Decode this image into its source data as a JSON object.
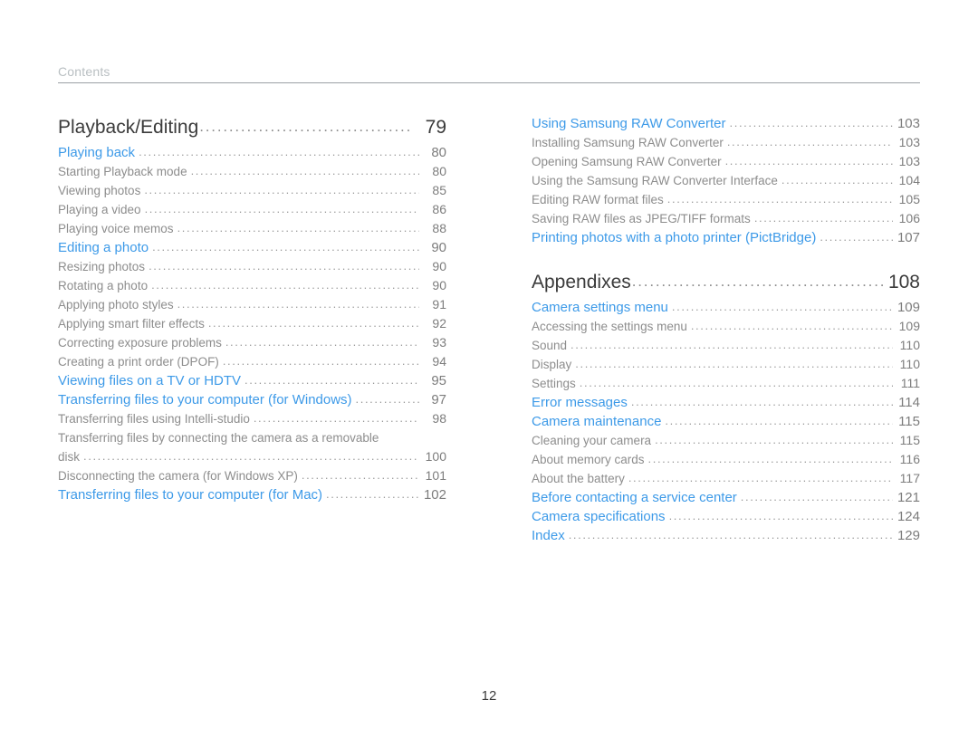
{
  "running_header": {
    "label": "Contents"
  },
  "folio": {
    "page_number": "12"
  },
  "colors": {
    "section_blue": "#3d9ae8",
    "sub_gray": "#8d8d8d",
    "chapter_dark": "#3b3b3b",
    "leader_gray": "#9a9a9a",
    "rule_gray": "#9aa0a4",
    "header_gray": "#b9bfc2"
  },
  "leader": "..................................................................................................",
  "left_column": [
    {
      "level": "chapter",
      "title": "Playback/Editing",
      "page": "79"
    },
    {
      "level": "section",
      "title": "Playing back",
      "page": "80"
    },
    {
      "level": "sub",
      "title": "Starting Playback mode",
      "page": "80"
    },
    {
      "level": "sub",
      "title": "Viewing photos",
      "page": "85"
    },
    {
      "level": "sub",
      "title": "Playing a video",
      "page": "86"
    },
    {
      "level": "sub",
      "title": "Playing voice memos",
      "page": "88"
    },
    {
      "level": "section",
      "title": "Editing a photo",
      "page": "90"
    },
    {
      "level": "sub",
      "title": "Resizing photos",
      "page": "90"
    },
    {
      "level": "sub",
      "title": "Rotating a photo",
      "page": "90"
    },
    {
      "level": "sub",
      "title": "Applying photo styles",
      "page": "91"
    },
    {
      "level": "sub",
      "title": "Applying smart filter effects",
      "page": "92"
    },
    {
      "level": "sub",
      "title": "Correcting exposure problems",
      "page": "93"
    },
    {
      "level": "sub",
      "title": "Creating a print order (DPOF)",
      "page": "94"
    },
    {
      "level": "section",
      "title": "Viewing files on a TV or HDTV",
      "page": "95"
    },
    {
      "level": "section",
      "title": "Transferring files to your computer (for Windows)",
      "page": "97"
    },
    {
      "level": "sub",
      "title": "Transferring files using Intelli-studio",
      "page": "98"
    },
    {
      "level": "sub-wrap",
      "title_line1": "Transferring files by connecting the camera as a removable",
      "title": "disk",
      "page": "100"
    },
    {
      "level": "sub",
      "title": "Disconnecting the camera (for Windows XP)",
      "page": "101"
    },
    {
      "level": "section",
      "title": "Transferring files to your computer (for Mac)",
      "page": "102"
    }
  ],
  "right_column_top": [
    {
      "level": "section",
      "title": "Using Samsung RAW Converter",
      "page": "103"
    },
    {
      "level": "sub",
      "title": "Installing Samsung RAW Converter",
      "page": "103"
    },
    {
      "level": "sub",
      "title": "Opening Samsung RAW Converter",
      "page": "103"
    },
    {
      "level": "sub",
      "title": "Using the Samsung RAW Converter Interface",
      "page": "104"
    },
    {
      "level": "sub",
      "title": "Editing RAW format files",
      "page": "105"
    },
    {
      "level": "sub",
      "title": "Saving RAW files as JPEG/TIFF formats",
      "page": "106"
    },
    {
      "level": "section",
      "title": "Printing photos with a photo printer (PictBridge)",
      "page": "107"
    }
  ],
  "right_column_bottom": [
    {
      "level": "chapter",
      "title": "Appendixes",
      "page": "108"
    },
    {
      "level": "section",
      "title": "Camera settings menu",
      "page": "109"
    },
    {
      "level": "sub",
      "title": "Accessing the settings menu",
      "page": "109"
    },
    {
      "level": "sub",
      "title": "Sound",
      "page": "110"
    },
    {
      "level": "sub",
      "title": "Display",
      "page": "110"
    },
    {
      "level": "sub",
      "title": "Settings",
      "page": "111"
    },
    {
      "level": "section",
      "title": "Error messages",
      "page": "114"
    },
    {
      "level": "section",
      "title": "Camera maintenance",
      "page": "115"
    },
    {
      "level": "sub",
      "title": "Cleaning your camera",
      "page": "115"
    },
    {
      "level": "sub",
      "title": "About memory cards",
      "page": "116"
    },
    {
      "level": "sub",
      "title": "About the battery",
      "page": "117"
    },
    {
      "level": "section",
      "title": "Before contacting a service center",
      "page": "121"
    },
    {
      "level": "section",
      "title": "Camera specifications",
      "page": "124"
    },
    {
      "level": "section",
      "title": "Index",
      "page": "129"
    }
  ]
}
